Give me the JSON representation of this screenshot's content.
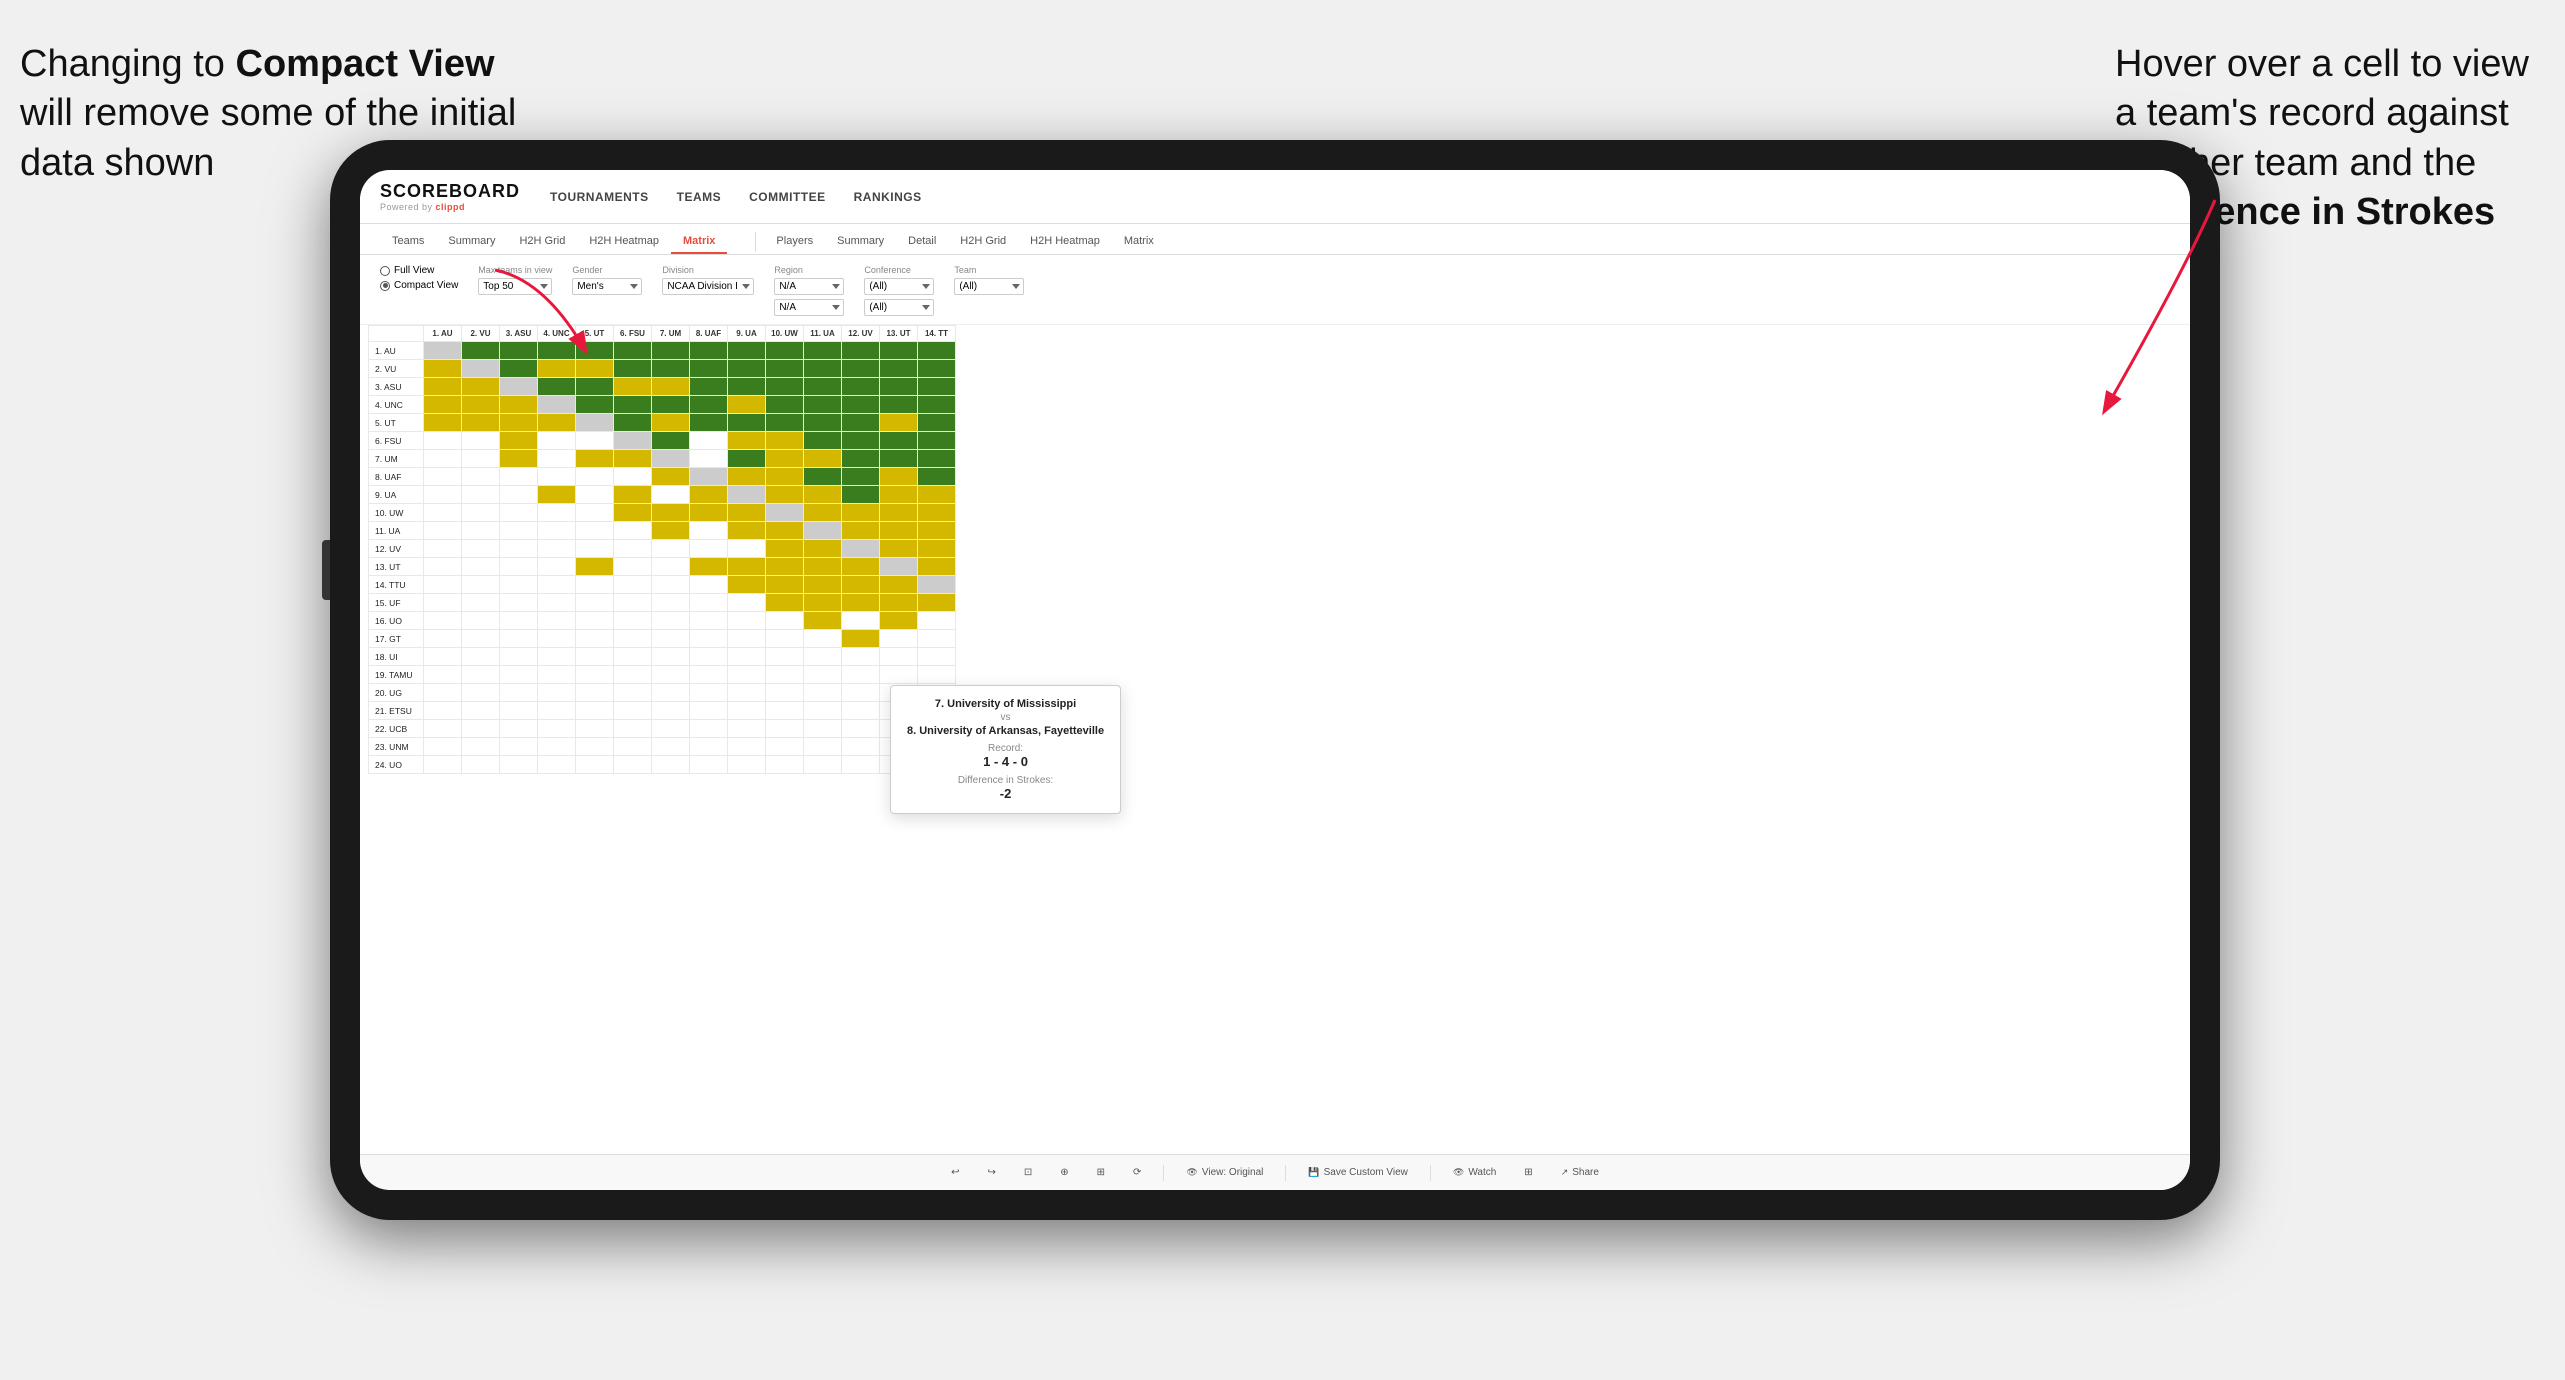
{
  "annotations": {
    "left_text": "Changing to Compact View will remove some of the initial data shown",
    "left_bold": "Compact View",
    "right_text": "Hover over a cell to view a team's record against another team and the Difference in Strokes",
    "right_bold": "Difference in Strokes"
  },
  "navbar": {
    "logo": "SCOREBOARD",
    "logo_sub": "Powered by clippd",
    "items": [
      "TOURNAMENTS",
      "TEAMS",
      "COMMITTEE",
      "RANKINGS"
    ]
  },
  "subnav": {
    "group1": [
      "Teams",
      "Summary",
      "H2H Grid",
      "H2H Heatmap",
      "Matrix"
    ],
    "group2": [
      "Players",
      "Summary",
      "Detail",
      "H2H Grid",
      "H2H Heatmap",
      "Matrix"
    ]
  },
  "controls": {
    "view_options": [
      "Full View",
      "Compact View"
    ],
    "selected_view": "Compact View",
    "max_teams_label": "Max teams in view",
    "max_teams_value": "Top 50",
    "gender_label": "Gender",
    "gender_value": "Men's",
    "division_label": "Division",
    "division_value": "NCAA Division I",
    "region_label": "Region",
    "region_value": "N/A",
    "conference_label": "Conference",
    "conference_values": [
      "(All)",
      "(All)"
    ],
    "team_label": "Team",
    "team_value": "(All)"
  },
  "matrix": {
    "col_headers": [
      "1. AU",
      "2. VU",
      "3. ASU",
      "4. UNC",
      "5. UT",
      "6. FSU",
      "7. UM",
      "8. UAF",
      "9. UA",
      "10. UW",
      "11. UA",
      "12. UV",
      "13. UT",
      "14. TT"
    ],
    "rows": [
      {
        "label": "1. AU",
        "cells": [
          "self",
          "green",
          "green",
          "green",
          "green",
          "green",
          "green",
          "green",
          "green",
          "green",
          "green",
          "green",
          "green",
          "green"
        ]
      },
      {
        "label": "2. VU",
        "cells": [
          "yellow",
          "self",
          "green",
          "yellow",
          "yellow",
          "green",
          "green",
          "green",
          "green",
          "green",
          "green",
          "green",
          "green",
          "green"
        ]
      },
      {
        "label": "3. ASU",
        "cells": [
          "yellow",
          "yellow",
          "self",
          "green",
          "green",
          "yellow",
          "yellow",
          "green",
          "green",
          "green",
          "green",
          "green",
          "green",
          "green"
        ]
      },
      {
        "label": "4. UNC",
        "cells": [
          "yellow",
          "yellow",
          "yellow",
          "self",
          "green",
          "green",
          "green",
          "green",
          "yellow",
          "green",
          "green",
          "green",
          "green",
          "green"
        ]
      },
      {
        "label": "5. UT",
        "cells": [
          "yellow",
          "yellow",
          "yellow",
          "yellow",
          "self",
          "green",
          "yellow",
          "green",
          "green",
          "green",
          "green",
          "green",
          "yellow",
          "green"
        ]
      },
      {
        "label": "6. FSU",
        "cells": [
          "white",
          "white",
          "yellow",
          "white",
          "white",
          "self",
          "green",
          "white",
          "yellow",
          "yellow",
          "green",
          "green",
          "green",
          "green"
        ]
      },
      {
        "label": "7. UM",
        "cells": [
          "white",
          "white",
          "yellow",
          "white",
          "yellow",
          "yellow",
          "self",
          "white",
          "green",
          "yellow",
          "yellow",
          "green",
          "green",
          "green"
        ]
      },
      {
        "label": "8. UAF",
        "cells": [
          "white",
          "white",
          "white",
          "white",
          "white",
          "white",
          "yellow",
          "self",
          "yellow",
          "yellow",
          "green",
          "green",
          "yellow",
          "green"
        ]
      },
      {
        "label": "9. UA",
        "cells": [
          "white",
          "white",
          "white",
          "yellow",
          "white",
          "yellow",
          "white",
          "yellow",
          "self",
          "yellow",
          "yellow",
          "green",
          "yellow",
          "yellow"
        ]
      },
      {
        "label": "10. UW",
        "cells": [
          "white",
          "white",
          "white",
          "white",
          "white",
          "yellow",
          "yellow",
          "yellow",
          "yellow",
          "self",
          "yellow",
          "yellow",
          "yellow",
          "yellow"
        ]
      },
      {
        "label": "11. UA",
        "cells": [
          "white",
          "white",
          "white",
          "white",
          "white",
          "white",
          "yellow",
          "white",
          "yellow",
          "yellow",
          "self",
          "yellow",
          "yellow",
          "yellow"
        ]
      },
      {
        "label": "12. UV",
        "cells": [
          "white",
          "white",
          "white",
          "white",
          "white",
          "white",
          "white",
          "white",
          "white",
          "yellow",
          "yellow",
          "self",
          "yellow",
          "yellow"
        ]
      },
      {
        "label": "13. UT",
        "cells": [
          "white",
          "white",
          "white",
          "white",
          "yellow",
          "white",
          "white",
          "yellow",
          "yellow",
          "yellow",
          "yellow",
          "yellow",
          "self",
          "yellow"
        ]
      },
      {
        "label": "14. TTU",
        "cells": [
          "white",
          "white",
          "white",
          "white",
          "white",
          "white",
          "white",
          "white",
          "yellow",
          "yellow",
          "yellow",
          "yellow",
          "yellow",
          "self"
        ]
      },
      {
        "label": "15. UF",
        "cells": [
          "white",
          "white",
          "white",
          "white",
          "white",
          "white",
          "white",
          "white",
          "white",
          "yellow",
          "yellow",
          "yellow",
          "yellow",
          "yellow"
        ]
      },
      {
        "label": "16. UO",
        "cells": [
          "white",
          "white",
          "white",
          "white",
          "white",
          "white",
          "white",
          "white",
          "white",
          "white",
          "yellow",
          "white",
          "yellow",
          "white"
        ]
      },
      {
        "label": "17. GT",
        "cells": [
          "white",
          "white",
          "white",
          "white",
          "white",
          "white",
          "white",
          "white",
          "white",
          "white",
          "white",
          "yellow",
          "white",
          "white"
        ]
      },
      {
        "label": "18. UI",
        "cells": [
          "white",
          "white",
          "white",
          "white",
          "white",
          "white",
          "white",
          "white",
          "white",
          "white",
          "white",
          "white",
          "white",
          "white"
        ]
      },
      {
        "label": "19. TAMU",
        "cells": [
          "white",
          "white",
          "white",
          "white",
          "white",
          "white",
          "white",
          "white",
          "white",
          "white",
          "white",
          "white",
          "white",
          "white"
        ]
      },
      {
        "label": "20. UG",
        "cells": [
          "white",
          "white",
          "white",
          "white",
          "white",
          "white",
          "white",
          "white",
          "white",
          "white",
          "white",
          "white",
          "white",
          "white"
        ]
      },
      {
        "label": "21. ETSU",
        "cells": [
          "white",
          "white",
          "white",
          "white",
          "white",
          "white",
          "white",
          "white",
          "white",
          "white",
          "white",
          "white",
          "white",
          "yellow"
        ]
      },
      {
        "label": "22. UCB",
        "cells": [
          "white",
          "white",
          "white",
          "white",
          "white",
          "white",
          "white",
          "white",
          "white",
          "white",
          "white",
          "white",
          "white",
          "white"
        ]
      },
      {
        "label": "23. UNM",
        "cells": [
          "white",
          "white",
          "white",
          "white",
          "white",
          "white",
          "white",
          "white",
          "white",
          "white",
          "white",
          "white",
          "white",
          "white"
        ]
      },
      {
        "label": "24. UO",
        "cells": [
          "white",
          "white",
          "white",
          "white",
          "white",
          "white",
          "white",
          "white",
          "white",
          "white",
          "white",
          "white",
          "white",
          "white"
        ]
      }
    ]
  },
  "tooltip": {
    "team1": "7. University of Mississippi",
    "vs": "vs",
    "team2": "8. University of Arkansas, Fayetteville",
    "record_label": "Record:",
    "record": "1 - 4 - 0",
    "diff_label": "Difference in Strokes:",
    "diff": "-2"
  },
  "toolbar": {
    "undo": "↩",
    "redo": "↪",
    "view_original": "View: Original",
    "save_custom": "Save Custom View",
    "watch": "Watch",
    "share": "Share"
  },
  "colors": {
    "dark_green": "#3a7d1e",
    "medium_green": "#5a9e30",
    "yellow": "#d4b800",
    "light_yellow": "#e8d040",
    "gray": "#a0a0a0",
    "red_arrow": "#e8183c",
    "accent_red": "#e74c3c"
  }
}
